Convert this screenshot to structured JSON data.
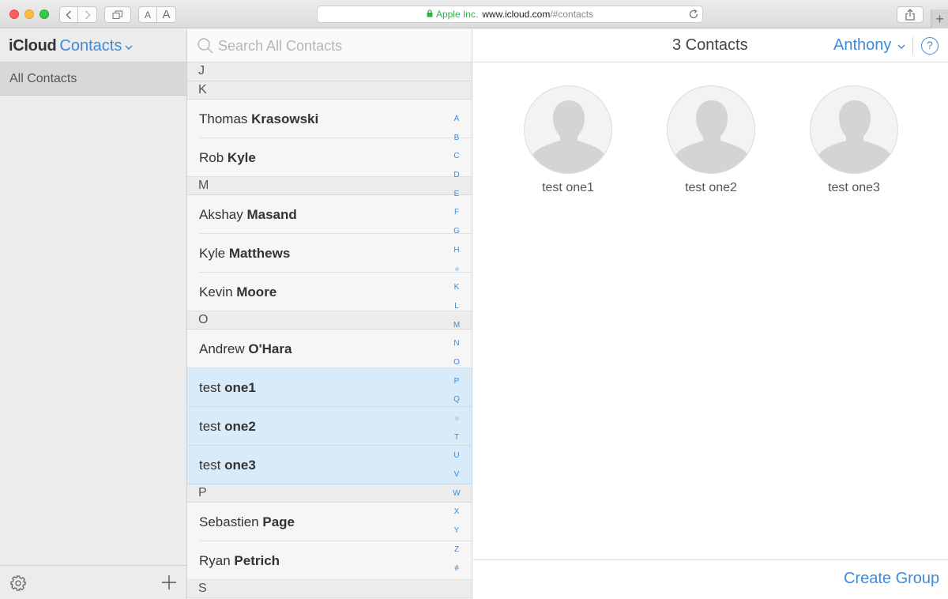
{
  "browser": {
    "address_org": "Apple Inc.",
    "address_host": "www.icloud.com",
    "address_path": "/#contacts",
    "text_smaller_label": "A",
    "text_larger_label": "A"
  },
  "sidebar": {
    "brand": "iCloud",
    "app_name": "Contacts",
    "groups": [
      {
        "label": "All Contacts"
      }
    ]
  },
  "search": {
    "placeholder": "Search All Contacts"
  },
  "contacts": {
    "sections": [
      {
        "letter": "J",
        "rows": []
      },
      {
        "letter": "K",
        "rows": [
          {
            "first": "Thomas",
            "last": "Krasowski",
            "selected": false
          },
          {
            "first": "Rob",
            "last": "Kyle",
            "selected": false
          }
        ]
      },
      {
        "letter": "M",
        "rows": [
          {
            "first": "Akshay",
            "last": "Masand",
            "selected": false
          },
          {
            "first": "Kyle",
            "last": "Matthews",
            "selected": false
          },
          {
            "first": "Kevin",
            "last": "Moore",
            "selected": false
          }
        ]
      },
      {
        "letter": "O",
        "rows": [
          {
            "first": "Andrew",
            "last": "O'Hara",
            "selected": false
          },
          {
            "first": "test",
            "last": "one1",
            "selected": true
          },
          {
            "first": "test",
            "last": "one2",
            "selected": true
          },
          {
            "first": "test",
            "last": "one3",
            "selected": true
          }
        ]
      },
      {
        "letter": "P",
        "rows": [
          {
            "first": "Sebastien",
            "last": "Page",
            "selected": false
          },
          {
            "first": "Ryan",
            "last": "Petrich",
            "selected": false
          }
        ]
      },
      {
        "letter": "S",
        "rows": []
      }
    ],
    "index_letters": [
      "A",
      "B",
      "C",
      "D",
      "E",
      "F",
      "G",
      "H",
      "•",
      "K",
      "L",
      "M",
      "N",
      "O",
      "P",
      "Q",
      "•",
      "T",
      "U",
      "V",
      "W",
      "X",
      "Y",
      "Z",
      "#"
    ]
  },
  "detail": {
    "count_label": "3 Contacts",
    "account_name": "Anthony",
    "help_label": "?",
    "selected_cards": [
      {
        "name": "test one1"
      },
      {
        "name": "test one2"
      },
      {
        "name": "test one3"
      }
    ],
    "create_group_label": "Create Group"
  },
  "colors": {
    "accent": "#3d8ad8",
    "selection": "#d9ebf8",
    "secure": "#2fb14b"
  }
}
